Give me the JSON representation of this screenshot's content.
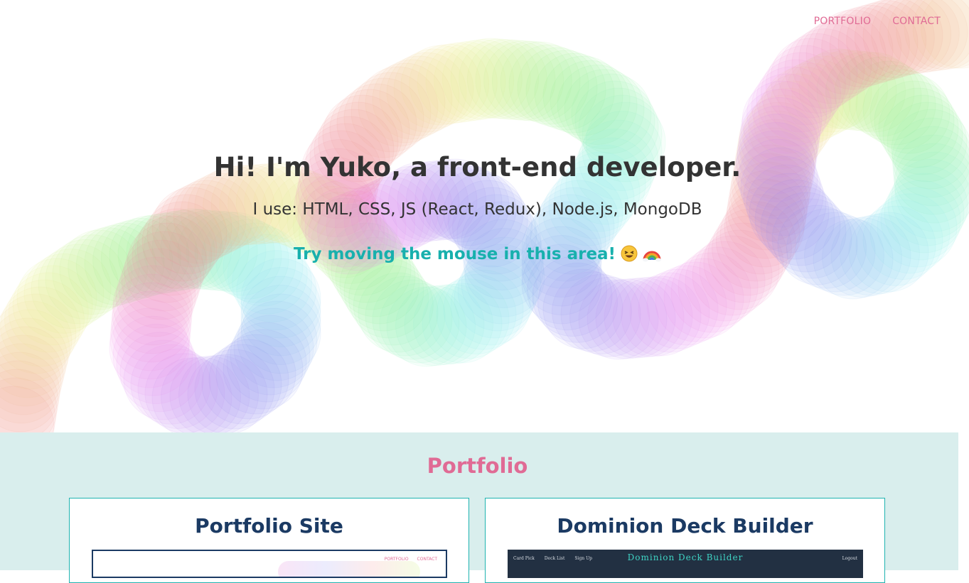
{
  "nav": {
    "items": [
      "PORTFOLIO",
      "CONTACT"
    ]
  },
  "hero": {
    "headline": "Hi! I'm Yuko, a front-end developer.",
    "uses": "I use: HTML, CSS, JS (React, Redux), Node.js, MongoDB",
    "tip": "Try moving the mouse in this area!",
    "tip_emojis": [
      "laughing-face-icon",
      "rainbow-icon"
    ]
  },
  "portfolio": {
    "title": "Portfolio",
    "cards": [
      {
        "title": "Portfolio Site",
        "preview_nav": [
          "PORTFOLIO",
          "CONTACT"
        ]
      },
      {
        "title": "Dominion Deck Builder",
        "preview_title": "Dominion Deck Builder",
        "preview_nav": [
          "Card Pick",
          "Deck List",
          "Sign Up"
        ],
        "preview_logout": "Logout"
      }
    ]
  },
  "colors": {
    "accent_pink": "#e06b95",
    "accent_teal": "#18b0ad",
    "section_bg": "#d9eeed",
    "card_title": "#1b3a63"
  }
}
